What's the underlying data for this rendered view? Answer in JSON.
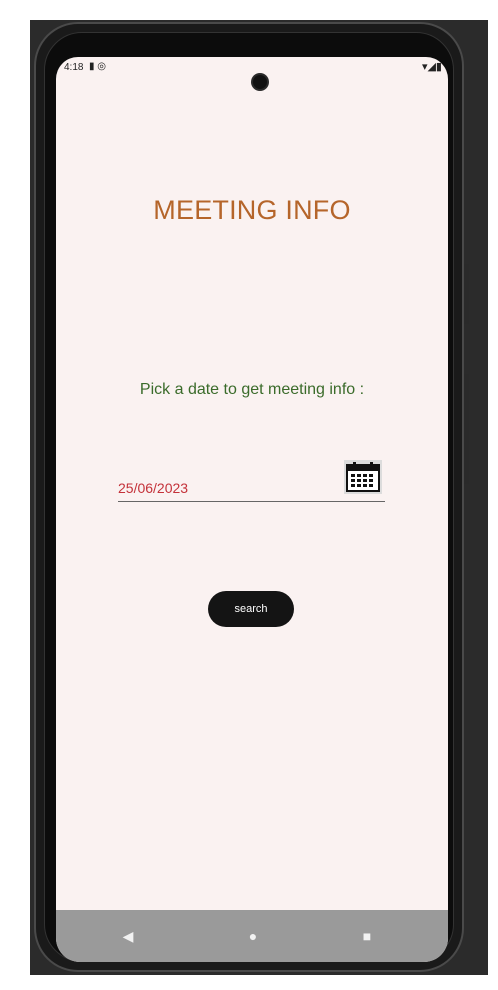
{
  "status_bar": {
    "time": "4:18",
    "left_icons": "▮ ◎",
    "right_icons": "▾◢▮"
  },
  "screen": {
    "title": "MEETING INFO",
    "prompt": "Pick a date to get meeting info :",
    "date_value": "25/06/2023",
    "search_label": "search"
  },
  "nav_bar": {
    "back": "◀",
    "home": "●",
    "recents": "■"
  },
  "colors": {
    "title": "#b5652a",
    "prompt": "#3a6b2a",
    "date": "#c4323a",
    "screen_bg": "#faf2f1",
    "button_bg": "#141414"
  }
}
